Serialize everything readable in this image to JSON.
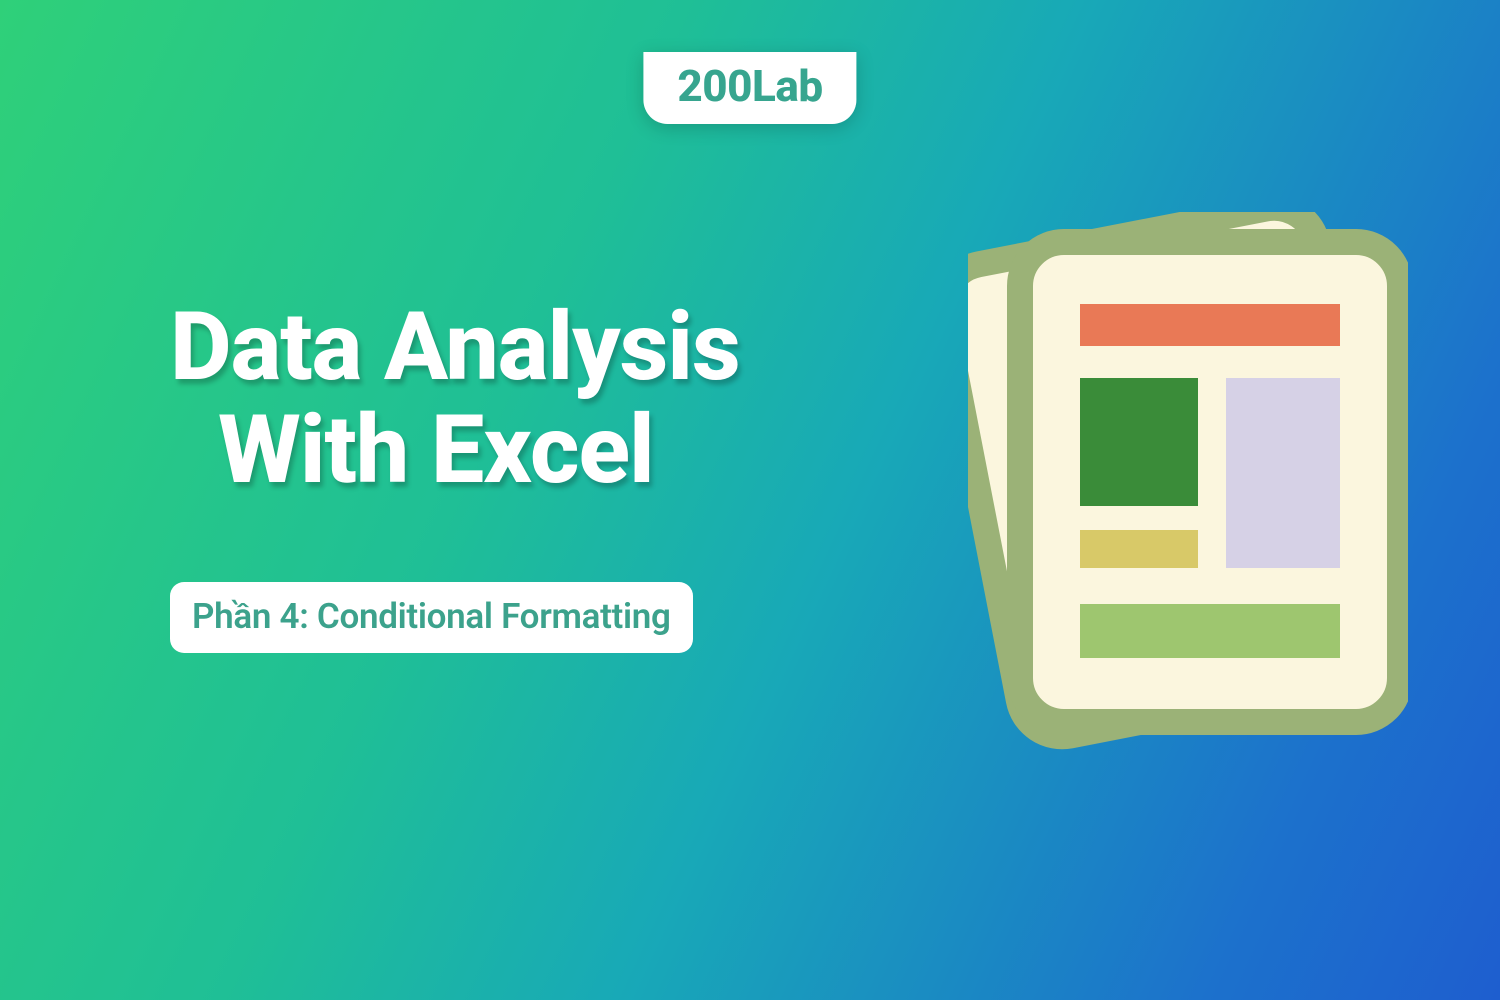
{
  "brand": {
    "logo_text": "200Lab"
  },
  "headline": {
    "line1": "Data Analysis",
    "line2": "With Excel"
  },
  "subtitle": {
    "text": "Phần 4: Conditional Formatting"
  },
  "palette": {
    "page_border": "#9bb277",
    "page_fill": "#fbf6de",
    "block_orange": "#e97956",
    "block_darkgreen": "#3a8c39",
    "block_lavender": "#d6d1e6",
    "block_olive": "#d8c968",
    "block_lightgreen": "#9ec66f",
    "logo_teal": "#37a58f",
    "subtitle_teal": "#3ca28c",
    "white": "#ffffff"
  }
}
